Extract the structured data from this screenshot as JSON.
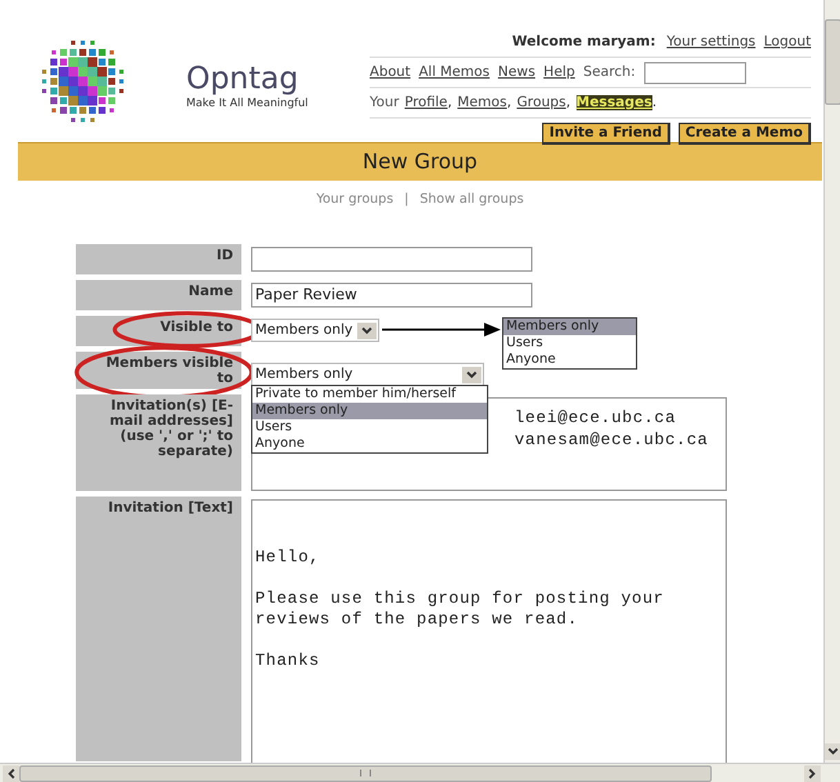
{
  "header": {
    "site_name": "Opntag",
    "tagline": "Make It All Meaningful",
    "welcome": "Welcome maryam:",
    "account_links": [
      "Your settings",
      "Logout"
    ],
    "nav_links": [
      "About",
      "All Memos",
      "News",
      "Help"
    ],
    "search": {
      "label": "Search:"
    },
    "your_nav": {
      "prefix": "Your",
      "links": [
        {
          "label": "Profile",
          "selected": false,
          "suffix": ","
        },
        {
          "label": "Memos",
          "selected": false,
          "suffix": ","
        },
        {
          "label": "Groups",
          "selected": false,
          "suffix": ","
        },
        {
          "label": "Messages",
          "selected": true,
          "suffix": "."
        }
      ]
    },
    "buttons": [
      "Invite a Friend",
      "Create a Memo"
    ]
  },
  "page_title": "New Group",
  "sub_links": [
    "Your groups",
    "|",
    "Show all groups"
  ],
  "form": {
    "fields": [
      {
        "label": "ID",
        "kind": "text",
        "circled": false
      },
      {
        "label": "Name",
        "kind": "text",
        "value": "Paper Review",
        "circled": false
      },
      {
        "label": "Visible to",
        "kind": "select",
        "value": "Members only",
        "circled": true,
        "callout": {
          "options": [
            {
              "label": "Members only",
              "selected": true
            },
            {
              "label": "Users",
              "selected": false
            },
            {
              "label": "Anyone",
              "selected": false
            }
          ]
        }
      },
      {
        "label": "Members visible to",
        "kind": "select",
        "value": "Members only",
        "circled": true,
        "open_list": {
          "options": [
            {
              "label": "Private to member him/herself",
              "selected": false
            },
            {
              "label": "Members only",
              "selected": true
            },
            {
              "label": "Users",
              "selected": false
            },
            {
              "label": "Anyone",
              "selected": false
            }
          ]
        }
      },
      {
        "label": "Invitation(s) [E-mail addresses] (use ',' or ';' to separate)",
        "kind": "emails",
        "value": "leei@ece.ubc.ca\nvanesam@ece.ubc.ca",
        "circled": false
      },
      {
        "label": "Invitation [Text]",
        "kind": "textarea",
        "value": "\n\nHello,\n\nPlease use this group for posting your\nreviews of the papers we read.\n\nThanks",
        "circled": false
      }
    ]
  }
}
